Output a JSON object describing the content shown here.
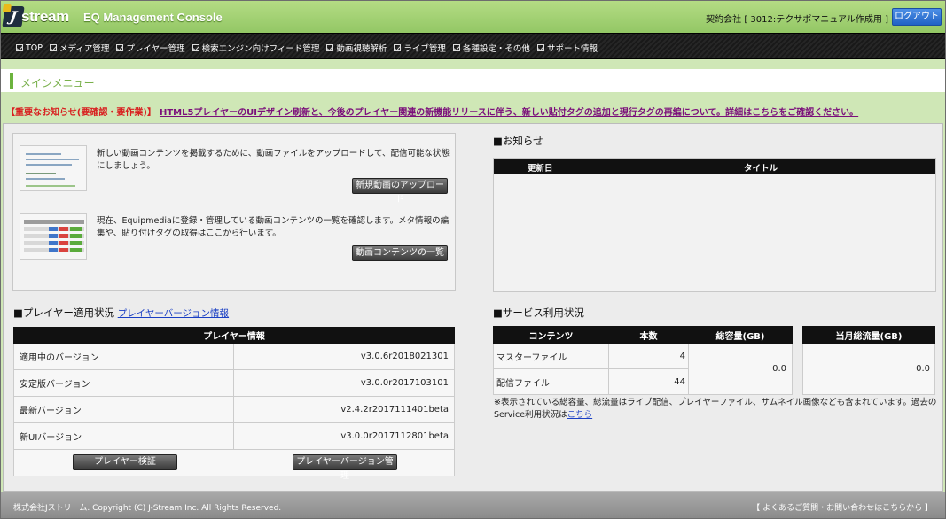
{
  "header": {
    "logo_text": "stream",
    "logo_letter": "J",
    "app_title": "EQ Management Console",
    "account": "契約会社 [ 3012:テクサポマニュアル作成用 ]",
    "logout_label": "ログアウト"
  },
  "nav": {
    "items": [
      {
        "label": "TOP"
      },
      {
        "label": "メディア管理"
      },
      {
        "label": "プレイヤー管理"
      },
      {
        "label": "検索エンジン向けフィード管理"
      },
      {
        "label": "動画視聴解析"
      },
      {
        "label": "ライブ管理"
      },
      {
        "label": "各種設定・その他"
      },
      {
        "label": "サポート情報"
      }
    ]
  },
  "menubar": {
    "title": "メインメニュー"
  },
  "notice": {
    "label": "【重要なお知らせ(要確認・要作業)】",
    "link_text": "HTML5プレイヤーのUIデザイン刷新と、今後のプレイヤー関連の新機能リリースに伴う、新しい貼付タグの追加と現行タグの再編について。詳細はこちらをご確認ください。"
  },
  "upload": {
    "description": "新しい動画コンテンツを掲載するために、動画ファイルをアップロードして、配信可能な状態にしましょう。",
    "button": "新規動画のアップロード"
  },
  "content_list": {
    "description": "現在、Equipmediaに登録・管理している動画コンテンツの一覧を確認します。メタ情報の編集や、貼り付けタグの取得はここから行います。",
    "button": "動画コンテンツの一覧"
  },
  "news": {
    "title": "■お知らせ",
    "col_date": "更新日",
    "col_title": "タイトル"
  },
  "player": {
    "title": "■プレイヤー適用状況",
    "link": "プレイヤーバージョン情報",
    "table_header": "プレイヤー情報",
    "rows": [
      {
        "label": "適用中のバージョン",
        "value": "v3.0.6r2018021301"
      },
      {
        "label": "安定版バージョン",
        "value": "v3.0.0r2017103101"
      },
      {
        "label": "最新バージョン",
        "value": "v2.4.2r2017111401beta"
      },
      {
        "label": "新UIバージョン",
        "value": "v3.0.0r2017112801beta"
      }
    ],
    "verify_button": "プレイヤー検証",
    "manage_button": "プレイヤーバージョン管理"
  },
  "service": {
    "title": "■サービス利用状況",
    "col_content": "コンテンツ",
    "col_count": "本数",
    "col_size": "総容量(GB)",
    "col_traffic": "当月総流量(GB)",
    "master_label": "マスターファイル",
    "master_count": "4",
    "delivery_label": "配信ファイル",
    "delivery_count": "44",
    "total_size": "0.0",
    "traffic": "0.0",
    "note": "※表示されている総容量、総流量はライブ配信、プレイヤーファイル、サムネイル画像なども含まれています。過去のService利用状況は",
    "note_link": "こちら"
  },
  "footer": {
    "copyright": "株式会社Jストリーム. Copyright (C) J-Stream Inc. All Rights Reserved.",
    "faq": "【 よくあるご質問・お問い合わせはこちらから 】"
  },
  "colors": {
    "header_green": "#93c765",
    "accent_green": "#6cb33e",
    "notice_red": "#d82020",
    "logout_blue": "#2062c5"
  }
}
